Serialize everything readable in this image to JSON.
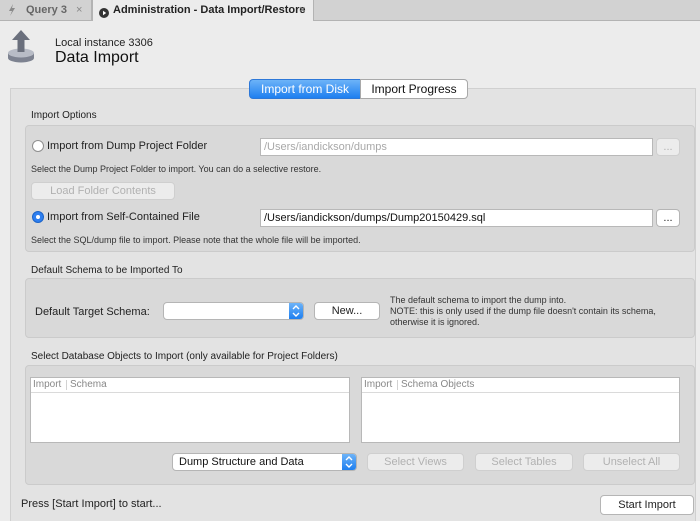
{
  "tabs": [
    {
      "label": "Query 3",
      "icon": "bolt-icon",
      "close": "×"
    },
    {
      "label": "Administration - Data Import/Restore",
      "icon": "play-circle-icon",
      "close": "×"
    }
  ],
  "header": {
    "instance": "Local instance 3306",
    "title": "Data Import",
    "icon": "import-arrow-icon"
  },
  "segments": [
    "Import from Disk",
    "Import Progress"
  ],
  "import_options": {
    "label": "Import Options",
    "project_folder": {
      "label": "Import from Dump Project Folder",
      "value": "/Users/iandickson/dumps",
      "browse": "...",
      "hint": "Select the Dump Project Folder to import. You can do a selective restore.",
      "load_button": "Load Folder Contents",
      "selected": false
    },
    "self_contained": {
      "label": "Import from Self-Contained File",
      "value": "/Users/iandickson/dumps/Dump20150429.sql",
      "browse": "...",
      "hint": "Select the SQL/dump file to import. Please note that the whole file will be imported.",
      "selected": true
    }
  },
  "default_schema": {
    "label": "Default Schema to be Imported To",
    "target_label": "Default Target Schema:",
    "new_button": "New...",
    "note_line1": "The default schema to import the dump into.",
    "note_line2": "NOTE: this is only used if the dump file doesn't contain its schema,",
    "note_line3": "otherwise it is ignored."
  },
  "db_objects": {
    "label": "Select Database Objects to Import (only available for Project Folders)",
    "left_cols": [
      "Import",
      "Schema"
    ],
    "right_cols": [
      "Import",
      "Schema Objects"
    ],
    "dump_select": "Dump Structure and Data",
    "select_views": "Select Views",
    "select_tables": "Select Tables",
    "unselect_all": "Unselect All"
  },
  "footer": {
    "status": "Press [Start Import] to start...",
    "start_button": "Start Import"
  }
}
